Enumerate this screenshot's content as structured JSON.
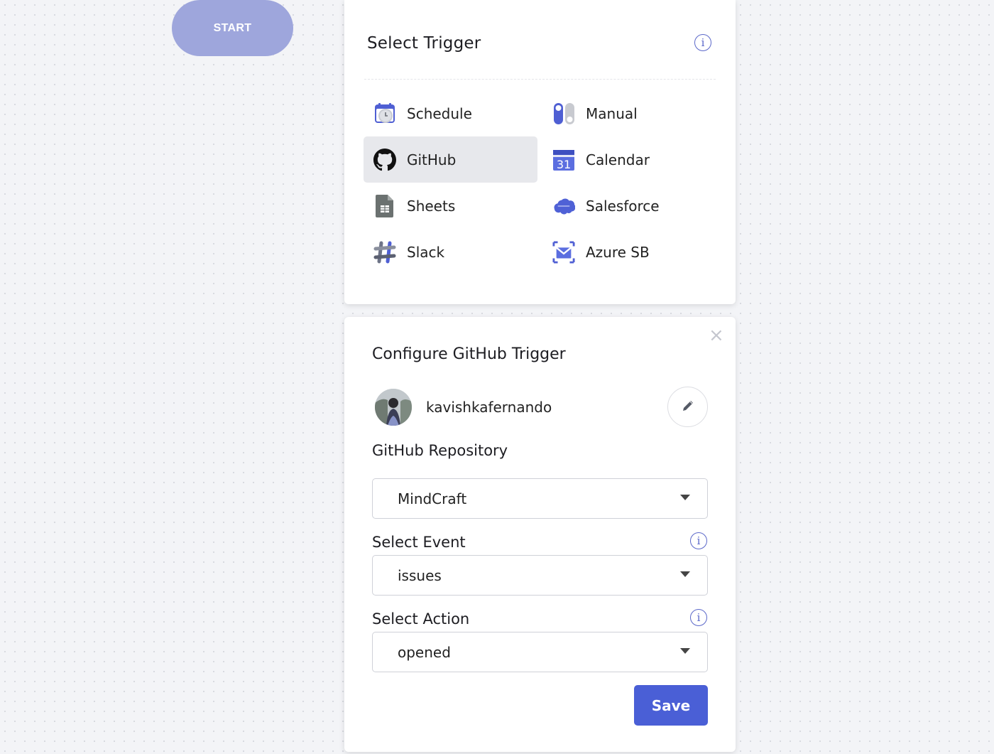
{
  "start_node": {
    "label": "START"
  },
  "trigger_panel": {
    "title": "Select Trigger",
    "items": [
      {
        "label": "Schedule",
        "icon": "schedule-icon"
      },
      {
        "label": "Manual",
        "icon": "toggle-icon"
      },
      {
        "label": "GitHub",
        "icon": "github-icon",
        "selected": true
      },
      {
        "label": "Calendar",
        "icon": "calendar-icon",
        "badge": "31"
      },
      {
        "label": "Sheets",
        "icon": "sheets-icon"
      },
      {
        "label": "Salesforce",
        "icon": "salesforce-icon"
      },
      {
        "label": "Slack",
        "icon": "slack-icon"
      },
      {
        "label": "Azure SB",
        "icon": "azure-service-bus-icon"
      }
    ]
  },
  "config_panel": {
    "title": "Configure GitHub Trigger",
    "username": "kavishkafernando",
    "repository": {
      "label": "GitHub Repository",
      "value": "MindCraft"
    },
    "event": {
      "label": "Select Event",
      "value": "issues"
    },
    "action": {
      "label": "Select Action",
      "value": "opened"
    },
    "save_label": "Save"
  },
  "colors": {
    "accent": "#4a5fd6",
    "start_node": "#9ea6dc",
    "selected_bg": "#e7e8ec"
  }
}
